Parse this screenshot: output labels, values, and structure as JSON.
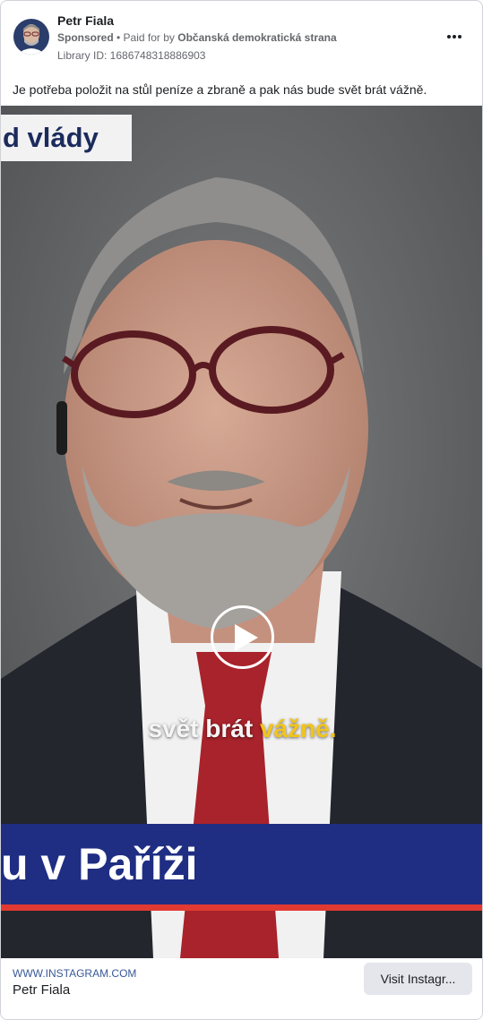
{
  "ad": {
    "page_name": "Petr Fiala",
    "sponsored_label": "Sponsored",
    "meta_separator": " • ",
    "paid_for_prefix": "Paid for by ",
    "payer": "Občanská demokratická strana",
    "library_id": "Library ID: 1686748318886903",
    "more_icon": "more-horizontal-icon",
    "caption": "Je potřeba položit na stůl peníze a zbraně a pak nás bude svět brát vážně."
  },
  "video": {
    "top_banner_text": "d vlády",
    "subtitle_part1": "svět brát ",
    "subtitle_part2": "vážně.",
    "bottom_banner_text": "u v Paříži",
    "play_icon": "play-icon",
    "colors": {
      "banner_blue": "#1f2e83",
      "banner_red": "#e13a32",
      "subtitle_accent": "#f2c41b",
      "top_banner_text": "#1b2b5c"
    }
  },
  "footer": {
    "url": "WWW.INSTAGRAM.COM",
    "title": "Petr Fiala",
    "cta_label": "Visit Instagr..."
  }
}
